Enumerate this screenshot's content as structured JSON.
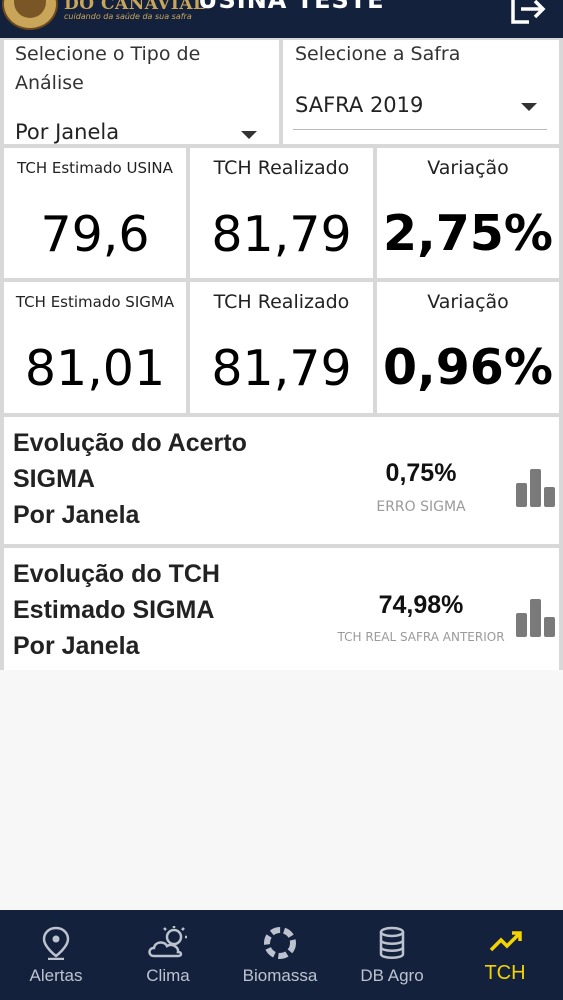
{
  "header": {
    "brand": "DO CANAVIAL",
    "brand_tagline": "cuidando da saúde da sua safra",
    "title": "USINA TESTE",
    "exit_icon": "logout-icon"
  },
  "filters": {
    "analysis_label": "Selecione o Tipo de Análise",
    "analysis_value": "Por Janela",
    "season_label": "Selecione a Safra",
    "season_value": "SAFRA 2019"
  },
  "metrics": {
    "row1": {
      "estimated_title": "TCH Estimado USINA",
      "estimated_value": "79,6",
      "realized_title": "TCH Realizado",
      "realized_value": "81,79",
      "variation_title": "Variação",
      "variation_value": "2,75%"
    },
    "row2": {
      "estimated_title": "TCH Estimado SIGMA",
      "estimated_value": "81,01",
      "realized_title": "TCH Realizado",
      "realized_value": "81,79",
      "variation_title": "Variação",
      "variation_value": "0,96%"
    }
  },
  "evolution": {
    "accuracy": {
      "title_line1": "Evolução do Acerto",
      "title_line2": "SIGMA",
      "title_line3": "Por Janela",
      "value": "0,75%",
      "caption": "ERRO SIGMA",
      "icon": "bar-chart-icon"
    },
    "estimated": {
      "title_line1": "Evolução do TCH",
      "title_line2": "Estimado SIGMA",
      "title_line3": "Por Janela",
      "value": "74,98%",
      "caption": "TCH REAL SAFRA ANTERIOR",
      "icon": "bar-chart-icon"
    }
  },
  "nav": {
    "items": [
      {
        "label": "Alertas",
        "icon": "map-pin-icon"
      },
      {
        "label": "Clima",
        "icon": "weather-icon"
      },
      {
        "label": "Biomassa",
        "icon": "biomass-icon"
      },
      {
        "label": "DB Agro",
        "icon": "database-icon"
      },
      {
        "label": "TCH",
        "icon": "trending-up-icon"
      }
    ],
    "active_index": 4,
    "active_color": "#f5d300"
  },
  "colors": {
    "header_bg": "#13213d",
    "brand_gold": "#c9a55a"
  }
}
